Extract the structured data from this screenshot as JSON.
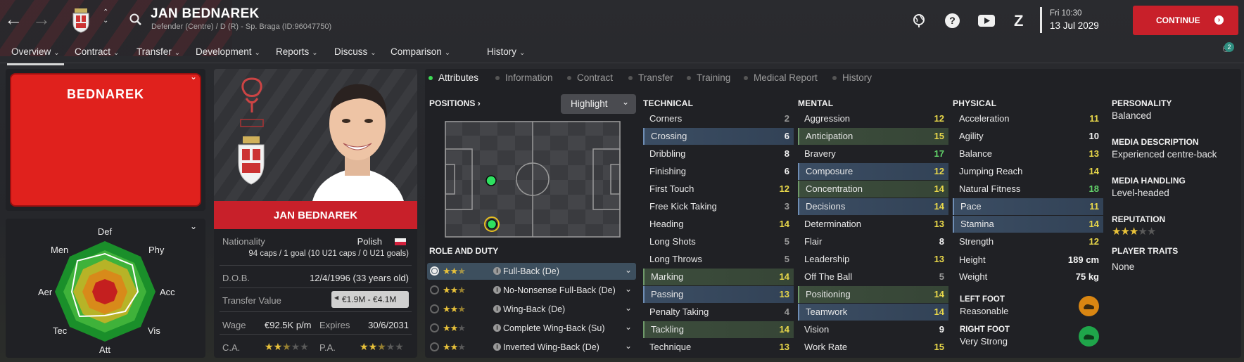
{
  "header": {
    "name": "JAN BEDNAREK",
    "subtitle": "Defender (Centre) / D (R) - Sp. Braga (ID:96047750)",
    "date_day": "Fri 10:30",
    "date": "13 Jul 2029",
    "continue_label": "CONTINUE",
    "notif_count": "2"
  },
  "menu": [
    {
      "label": "Overview"
    },
    {
      "label": "Contract"
    },
    {
      "label": "Transfer"
    },
    {
      "label": "Development"
    },
    {
      "label": "Reports"
    },
    {
      "label": "Discuss"
    },
    {
      "label": "Comparison"
    },
    {
      "label": "History"
    }
  ],
  "kit": {
    "label": "BEDNAREK"
  },
  "profile": {
    "name": "JAN BEDNAREK",
    "nationality_label": "Nationality",
    "nationality": "Polish",
    "caps": "94 caps / 1 goal (10 U21 caps / 0 U21 goals)",
    "dob_label": "D.O.B.",
    "dob": "12/4/1996 (33 years old)",
    "tv_label": "Transfer Value",
    "tv": "€1.9M - €4.1M",
    "wage_label": "Wage",
    "wage": "€92.5K p/m",
    "expires_label": "Expires",
    "expires": "30/6/2031",
    "ca_label": "C.A.",
    "pa_label": "P.A.",
    "ca_stars": 2.5,
    "pa_stars": 2.5
  },
  "radar": {
    "labels": [
      "Def",
      "Phy",
      "Acc",
      "Vis",
      "Att",
      "Tec",
      "Aer",
      "Men"
    ]
  },
  "tabs": [
    {
      "label": "Attributes"
    },
    {
      "label": "Information"
    },
    {
      "label": "Contract"
    },
    {
      "label": "Transfer"
    },
    {
      "label": "Training"
    },
    {
      "label": "Medical Report"
    },
    {
      "label": "History"
    }
  ],
  "positions": {
    "title": "POSITIONS",
    "highlight_label": "Highlight"
  },
  "role": {
    "title": "ROLE AND DUTY",
    "duties": [
      {
        "name": "Full-Back (De)",
        "stars": 2.5,
        "selected": true
      },
      {
        "name": "No-Nonsense Full-Back (De)",
        "stars": 2.5
      },
      {
        "name": "Wing-Back (De)",
        "stars": 2.5
      },
      {
        "name": "Complete Wing-Back (Su)",
        "stars": 2
      },
      {
        "name": "Inverted Wing-Back (De)",
        "stars": 2
      }
    ]
  },
  "technical": {
    "title": "TECHNICAL",
    "attrs": [
      {
        "label": "Corners",
        "value": "2"
      },
      {
        "label": "Crossing",
        "value": "6",
        "hl": "blue"
      },
      {
        "label": "Dribbling",
        "value": "8"
      },
      {
        "label": "Finishing",
        "value": "6"
      },
      {
        "label": "First Touch",
        "value": "12"
      },
      {
        "label": "Free Kick Taking",
        "value": "3"
      },
      {
        "label": "Heading",
        "value": "14"
      },
      {
        "label": "Long Shots",
        "value": "5"
      },
      {
        "label": "Long Throws",
        "value": "5"
      },
      {
        "label": "Marking",
        "value": "14",
        "hl": "green"
      },
      {
        "label": "Passing",
        "value": "13",
        "hl": "blue"
      },
      {
        "label": "Penalty Taking",
        "value": "4"
      },
      {
        "label": "Tackling",
        "value": "14",
        "hl": "green"
      },
      {
        "label": "Technique",
        "value": "13"
      }
    ]
  },
  "mental": {
    "title": "MENTAL",
    "attrs": [
      {
        "label": "Aggression",
        "value": "12"
      },
      {
        "label": "Anticipation",
        "value": "15",
        "hl": "green"
      },
      {
        "label": "Bravery",
        "value": "17"
      },
      {
        "label": "Composure",
        "value": "12",
        "hl": "blue"
      },
      {
        "label": "Concentration",
        "value": "14",
        "hl": "green"
      },
      {
        "label": "Decisions",
        "value": "14",
        "hl": "blue"
      },
      {
        "label": "Determination",
        "value": "13"
      },
      {
        "label": "Flair",
        "value": "8"
      },
      {
        "label": "Leadership",
        "value": "13"
      },
      {
        "label": "Off The Ball",
        "value": "5"
      },
      {
        "label": "Positioning",
        "value": "14",
        "hl": "green"
      },
      {
        "label": "Teamwork",
        "value": "14",
        "hl": "blue"
      },
      {
        "label": "Vision",
        "value": "9"
      },
      {
        "label": "Work Rate",
        "value": "15"
      }
    ]
  },
  "physical": {
    "title": "PHYSICAL",
    "attrs": [
      {
        "label": "Acceleration",
        "value": "11"
      },
      {
        "label": "Agility",
        "value": "10"
      },
      {
        "label": "Balance",
        "value": "13"
      },
      {
        "label": "Jumping Reach",
        "value": "14"
      },
      {
        "label": "Natural Fitness",
        "value": "18"
      },
      {
        "label": "Pace",
        "value": "11",
        "hl": "blue"
      },
      {
        "label": "Stamina",
        "value": "14",
        "hl": "blue"
      },
      {
        "label": "Strength",
        "value": "12"
      }
    ],
    "height_label": "Height",
    "height": "189 cm",
    "weight_label": "Weight",
    "weight": "75 kg",
    "left_foot_label": "LEFT FOOT",
    "left_foot": "Reasonable",
    "right_foot_label": "RIGHT FOOT",
    "right_foot": "Very Strong"
  },
  "side": {
    "personality_label": "PERSONALITY",
    "personality": "Balanced",
    "media_desc_label": "MEDIA DESCRIPTION",
    "media_desc": "Experienced centre-back",
    "media_handling_label": "MEDIA HANDLING",
    "media_handling": "Level-headed",
    "reputation_label": "REPUTATION",
    "reputation_stars": 3,
    "traits_label": "PLAYER TRAITS",
    "traits": "None"
  },
  "colors": {
    "accent_red": "#c8202a",
    "grey": "#9a9a9a",
    "white": "#f2f2f2",
    "yellow": "#e9d84a",
    "green": "#62d36a"
  }
}
